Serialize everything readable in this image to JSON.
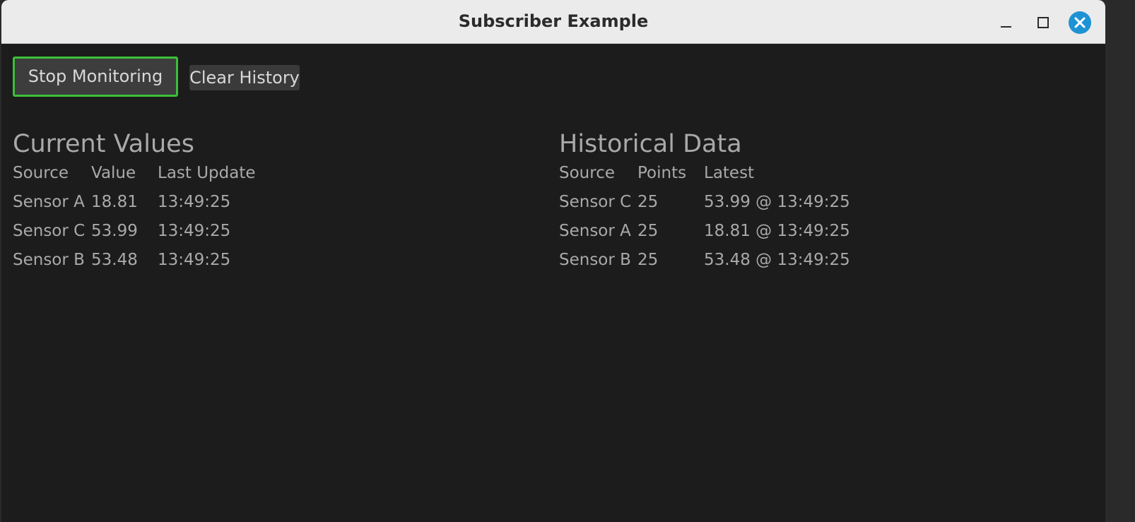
{
  "window": {
    "title": "Subscriber Example"
  },
  "toolbar": {
    "stop_label": "Stop Monitoring",
    "clear_label": "Clear History"
  },
  "current": {
    "title": "Current Values",
    "headers": [
      "Source",
      "Value",
      "Last Update"
    ],
    "rows": [
      [
        "Sensor A",
        "18.81",
        "13:49:25"
      ],
      [
        "Sensor C",
        "53.99",
        "13:49:25"
      ],
      [
        "Sensor B",
        "53.48",
        "13:49:25"
      ]
    ]
  },
  "history": {
    "title": "Historical Data",
    "headers": [
      "Source",
      "Points",
      "Latest"
    ],
    "rows": [
      [
        "Sensor C",
        "25",
        "53.99 @ 13:49:25"
      ],
      [
        "Sensor A",
        "25",
        "18.81 @ 13:49:25"
      ],
      [
        "Sensor B",
        "25",
        "53.48 @ 13:49:25"
      ]
    ]
  },
  "colors": {
    "accent_focus": "#3cbf3a",
    "close_button": "#1e93d4",
    "background": "#1c1c1c"
  }
}
